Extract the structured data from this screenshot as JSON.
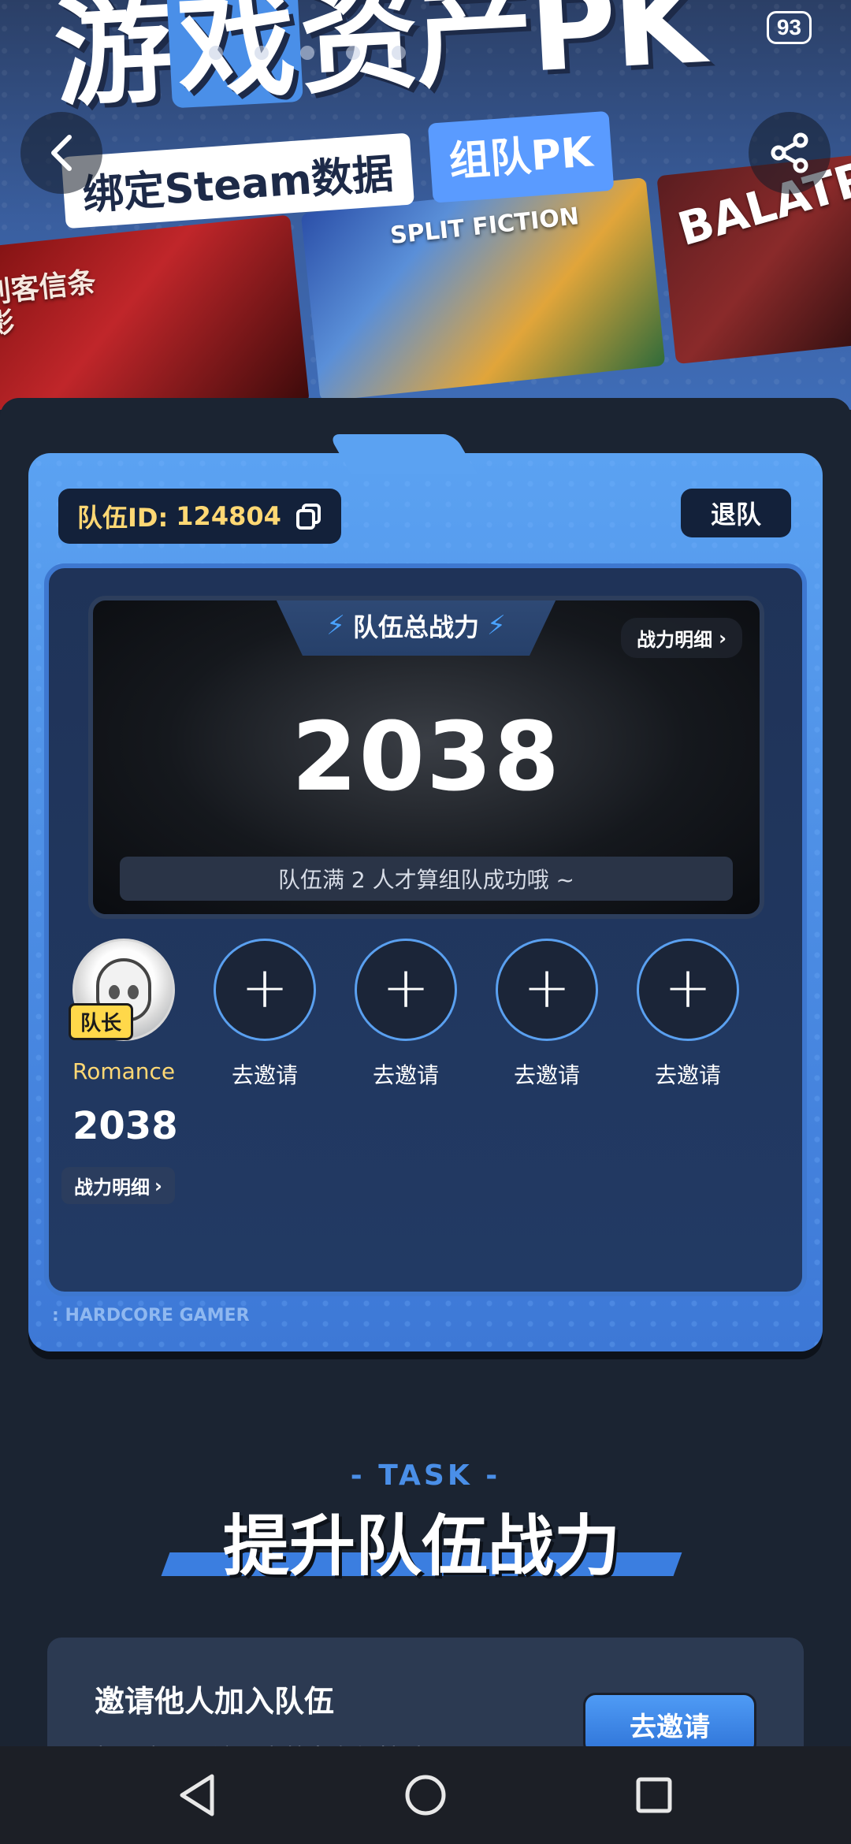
{
  "status_bar": {
    "battery": "93"
  },
  "hero": {
    "title_part1": "游",
    "title_highlight": "戏",
    "title_part2": "资产PK",
    "subtitle_left": "绑定Steam数据",
    "subtitle_right": "组队PK",
    "posters": [
      {
        "title": "刺客信条 影"
      },
      {
        "title": "SPLIT FICTION"
      },
      {
        "title": "BALATRO"
      }
    ]
  },
  "team": {
    "id_label": "队伍ID:",
    "id_value": "124804",
    "quit_label": "退队",
    "power_header": "队伍总战力",
    "power_detail_label": "战力明细",
    "power_value": "2038",
    "note": "队伍满 2 人才算组队成功哦 ~",
    "brand": ": HARDCORE GAMER",
    "members": [
      {
        "name": "Romance",
        "captain_badge": "队长",
        "score": "2038",
        "detail_label": "战力明细"
      },
      {
        "name": "去邀请"
      },
      {
        "name": "去邀请"
      },
      {
        "name": "去邀请"
      },
      {
        "name": "去邀请"
      }
    ]
  },
  "task": {
    "label": "- TASK -",
    "title": "提升队伍战力",
    "card_title": "邀请他人加入队伍",
    "card_desc": "新用户、回流用户战力有加持哦",
    "card_button": "去邀请"
  },
  "colors": {
    "accent": "#4a8fe8",
    "gold": "#ffd874",
    "panel": "#1b2432"
  }
}
